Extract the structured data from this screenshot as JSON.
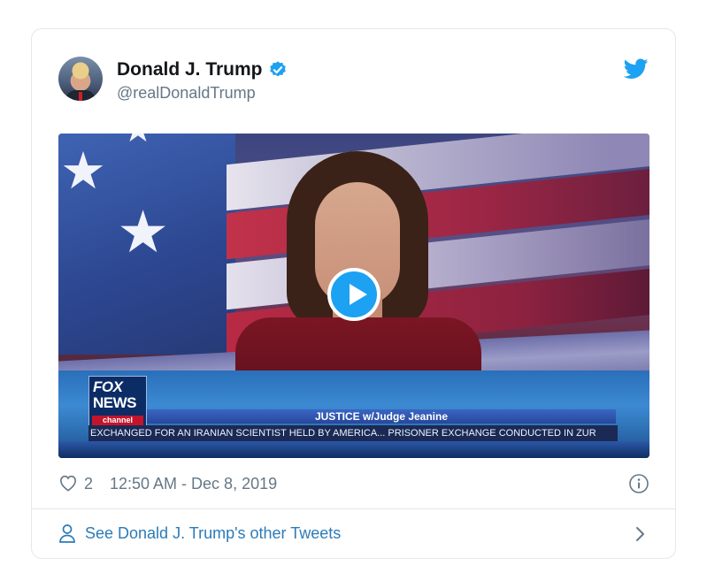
{
  "tweet": {
    "author_name": "Donald J. Trump",
    "author_handle": "@realDonaldTrump",
    "verified": true,
    "likes": "2",
    "timestamp": "12:50 AM - Dec 8, 2019"
  },
  "video": {
    "network_logo_top": "FOX",
    "network_logo_bottom": "NEWS",
    "network_logo_channel": "channel",
    "show_title": "JUSTICE w/Judge Jeanine",
    "ticker": "EXCHANGED FOR AN IRANIAN SCIENTIST HELD  BY AMERICA...   PRISONER EXCHANGE CONDUCTED IN ZUR"
  },
  "footer": {
    "see_more_label": "See Donald J. Trump's other Tweets"
  },
  "colors": {
    "accent": "#1da1f2",
    "link": "#2b7bb9",
    "muted": "#657786"
  },
  "icons": [
    "verified-badge-icon",
    "twitter-bird-icon",
    "play-icon",
    "heart-icon",
    "info-icon",
    "person-icon",
    "chevron-right-icon"
  ]
}
